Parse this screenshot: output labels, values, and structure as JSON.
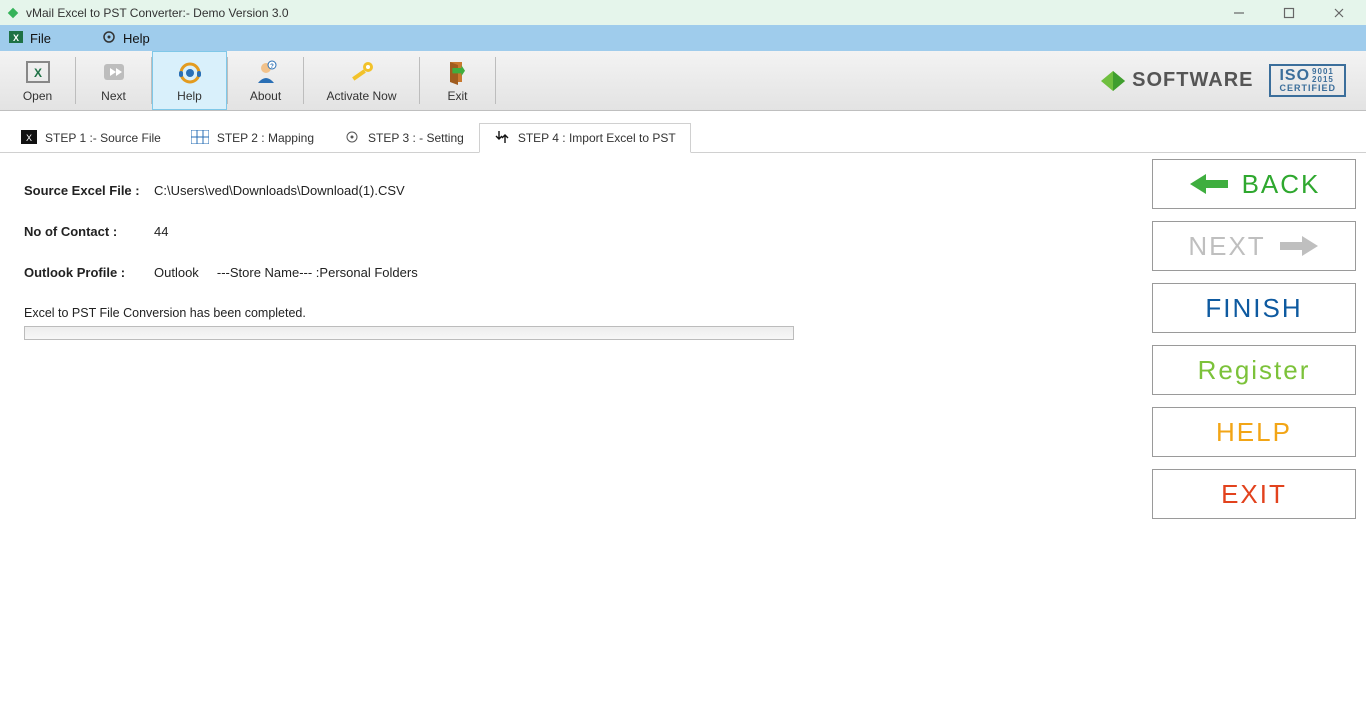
{
  "window": {
    "title": "vMail Excel to PST Converter:- Demo Version 3.0"
  },
  "menubar": {
    "file": "File",
    "help": "Help"
  },
  "toolbar": {
    "open": "Open",
    "next": "Next",
    "help": "Help",
    "about": "About",
    "activate": "Activate Now",
    "exit": "Exit",
    "brand": "SOFTWARE",
    "iso_top": "ISO",
    "iso_9001": "9001",
    "iso_2015": "2015",
    "iso_cert": "CERTIFIED"
  },
  "tabs": {
    "step1": "STEP 1 :- Source File",
    "step2": "STEP 2 : Mapping",
    "step3": "STEP 3 : - Setting",
    "step4": "STEP 4 : Import Excel to PST"
  },
  "details": {
    "source_label": "Source Excel File :",
    "source_value": "C:\\Users\\ved\\Downloads\\Download(1).CSV",
    "contact_label": "No of Contact :",
    "contact_value": "44",
    "profile_label": "Outlook Profile :",
    "profile_value": "Outlook     ---Store Name--- :Personal Folders",
    "status": "Excel to PST File Conversion has been completed."
  },
  "side": {
    "back": "BACK",
    "next": "NEXT",
    "finish": "FINISH",
    "register": "Register",
    "help": "HELP",
    "exit": "EXIT"
  }
}
